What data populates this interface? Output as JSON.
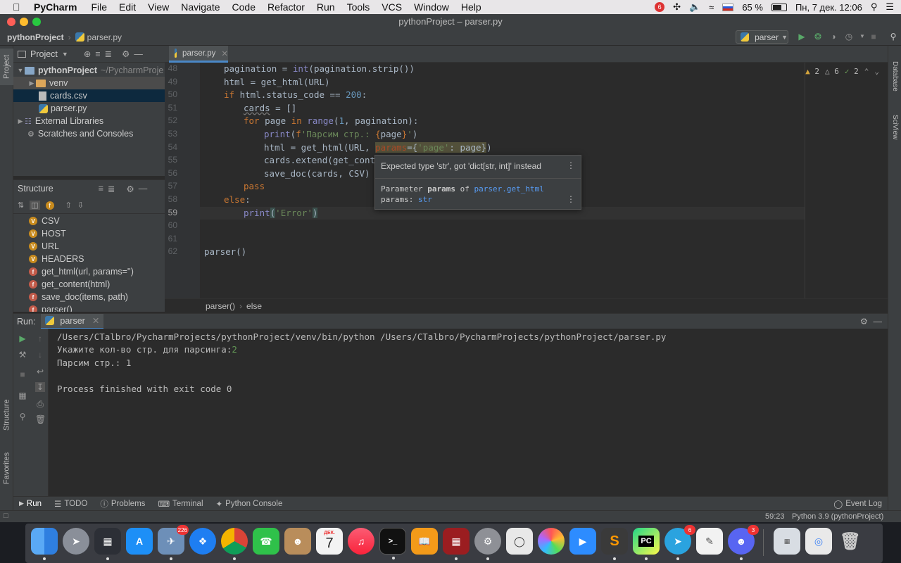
{
  "menubar": {
    "app": "PyCharm",
    "items": [
      "File",
      "Edit",
      "View",
      "Navigate",
      "Code",
      "Refactor",
      "Run",
      "Tools",
      "VCS",
      "Window",
      "Help"
    ],
    "rec_badge": "6",
    "battery": "65 %",
    "datetime": "Пн, 7 дек.  12:06"
  },
  "window": {
    "title": "pythonProject – parser.py"
  },
  "navbar": {
    "project": "pythonProject",
    "file": "parser.py",
    "run_config": "parser"
  },
  "left_strip": {
    "project": "Project",
    "structure": "Structure",
    "favorites": "Favorites"
  },
  "right_strip": {
    "database": "Database",
    "sciview": "SciView"
  },
  "project_panel": {
    "title": "Project",
    "root": "pythonProject",
    "root_path": "~/PycharmProje",
    "items": [
      "venv",
      "cards.csv",
      "parser.py",
      "External Libraries",
      "Scratches and Consoles"
    ]
  },
  "structure_panel": {
    "title": "Structure",
    "items": [
      {
        "badge": "V",
        "label": "CSV"
      },
      {
        "badge": "V",
        "label": "HOST"
      },
      {
        "badge": "V",
        "label": "URL"
      },
      {
        "badge": "V",
        "label": "HEADERS"
      },
      {
        "badge": "f",
        "label": "get_html(url, params='')"
      },
      {
        "badge": "f",
        "label": "get_content(html)"
      },
      {
        "badge": "f",
        "label": "save_doc(items, path)"
      },
      {
        "badge": "f",
        "label": "parser()"
      }
    ]
  },
  "editor": {
    "tab": "parser.py",
    "inspections": {
      "warnings": "2",
      "weak_warnings": "6",
      "ok": "2"
    },
    "line_numbers": [
      "48",
      "49",
      "50",
      "51",
      "52",
      "53",
      "54",
      "55",
      "56",
      "57",
      "58",
      "59",
      "60",
      "61",
      "62"
    ],
    "breadcrumb": [
      "parser()",
      "else"
    ]
  },
  "tooltip": {
    "message": "Expected type 'str', got 'dict[str, int]' instead",
    "param_prefix": "Parameter",
    "param_name": "params",
    "param_of": "of",
    "param_func": "parser.get_html",
    "param_type_label": "params:",
    "param_type": "str"
  },
  "run": {
    "label": "Run:",
    "tab": "parser",
    "console": {
      "cmd": "/Users/CTalbro/PycharmProjects/pythonProject/venv/bin/python /Users/CTalbro/PycharmProjects/pythonProject/parser.py",
      "prompt": "Укажите кол-во стр. для парсинга:",
      "input": "2",
      "progress": "Парсим стр.: 1",
      "finish": "Process finished with exit code 0"
    }
  },
  "bottom_tools": [
    "Run",
    "TODO",
    "Problems",
    "Terminal",
    "Python Console"
  ],
  "event_log": "Event Log",
  "status": {
    "position": "59:23",
    "interpreter": "Python 3.9 (pythonProject)"
  },
  "dock": {
    "badges": {
      "app_store_like": "226",
      "calendar_month": "ДЕК.",
      "calendar_day": "7",
      "telegram": "6",
      "discord": "3"
    }
  }
}
